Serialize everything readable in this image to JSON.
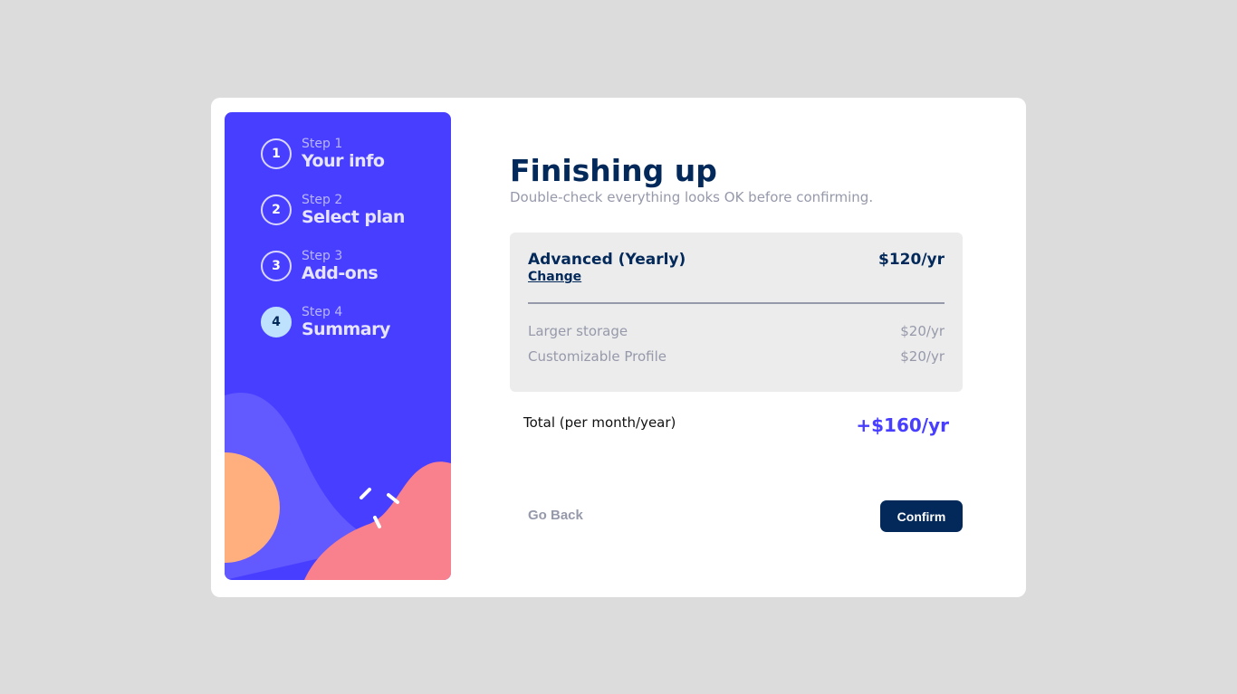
{
  "steps": [
    {
      "number": "1",
      "label": "Step 1",
      "title": "Your info"
    },
    {
      "number": "2",
      "label": "Step 2",
      "title": "Select plan"
    },
    {
      "number": "3",
      "label": "Step 3",
      "title": "Add-ons"
    },
    {
      "number": "4",
      "label": "Step 4",
      "title": "Summary",
      "active": true
    }
  ],
  "header": {
    "title": "Finishing up",
    "subtitle": "Double-check everything looks OK before confirming."
  },
  "summary": {
    "plan_name": "Advanced (Yearly)",
    "change_label": "Change",
    "plan_price": "$120/yr",
    "addons": [
      {
        "name": "Larger storage",
        "price": "$20/yr"
      },
      {
        "name": "Customizable Profile",
        "price": "$20/yr"
      }
    ]
  },
  "total": {
    "label": "Total (per month/year)",
    "price": "+$160/yr"
  },
  "buttons": {
    "back_label": "Go Back",
    "confirm_label": "Confirm"
  },
  "colors": {
    "sidebar": "#483eff",
    "marine_blue": "#022959",
    "purplish_blue": "#483eff",
    "pastel_blue": "#bee2fd",
    "orange_blob": "#ffaf7e",
    "pink_blob": "#f9818e",
    "purple_blob": "#6259ff"
  }
}
